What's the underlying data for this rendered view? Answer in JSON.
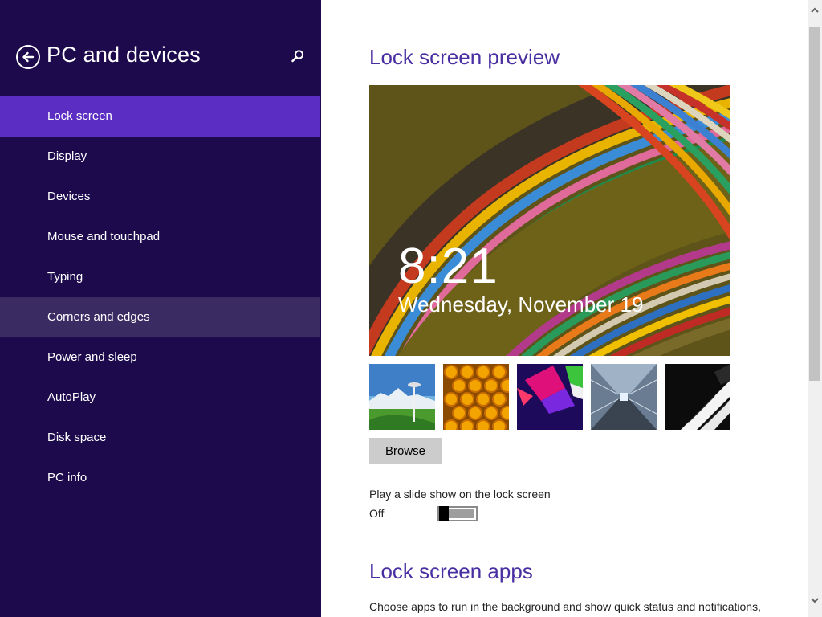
{
  "sidebar": {
    "title": "PC and devices",
    "back_icon": "back-arrow-circle-icon",
    "search_icon": "search-icon",
    "items": [
      {
        "label": "Lock screen",
        "state": "selected"
      },
      {
        "label": "Display"
      },
      {
        "label": "Devices"
      },
      {
        "label": "Mouse and touchpad"
      },
      {
        "label": "Typing"
      },
      {
        "label": "Corners and edges",
        "state": "hover"
      },
      {
        "label": "Power and sleep"
      },
      {
        "label": "AutoPlay"
      },
      {
        "label": "Disk space"
      },
      {
        "label": "PC info"
      }
    ]
  },
  "main": {
    "preview_title": "Lock screen preview",
    "preview": {
      "time": "8:21",
      "date": "Wednesday, November 19"
    },
    "thumbnails": [
      {
        "name": "seattle-space-needle-thumbnail"
      },
      {
        "name": "honeycomb-thumbnail"
      },
      {
        "name": "geometric-shapes-thumbnail"
      },
      {
        "name": "tunnel-motion-thumbnail"
      },
      {
        "name": "piano-keys-thumbnail"
      }
    ],
    "browse_label": "Browse",
    "slideshow_label": "Play a slide show on the lock screen",
    "slideshow_state": "Off",
    "apps_title": "Lock screen apps",
    "apps_description": "Choose apps to run in the background and show quick status and notifications,"
  },
  "colors": {
    "sidebar_bg": "#1c0a4d",
    "selected_item": "#5b2dc2",
    "hover_item": "#3a2b63",
    "accent_text": "#4a2fa3"
  }
}
